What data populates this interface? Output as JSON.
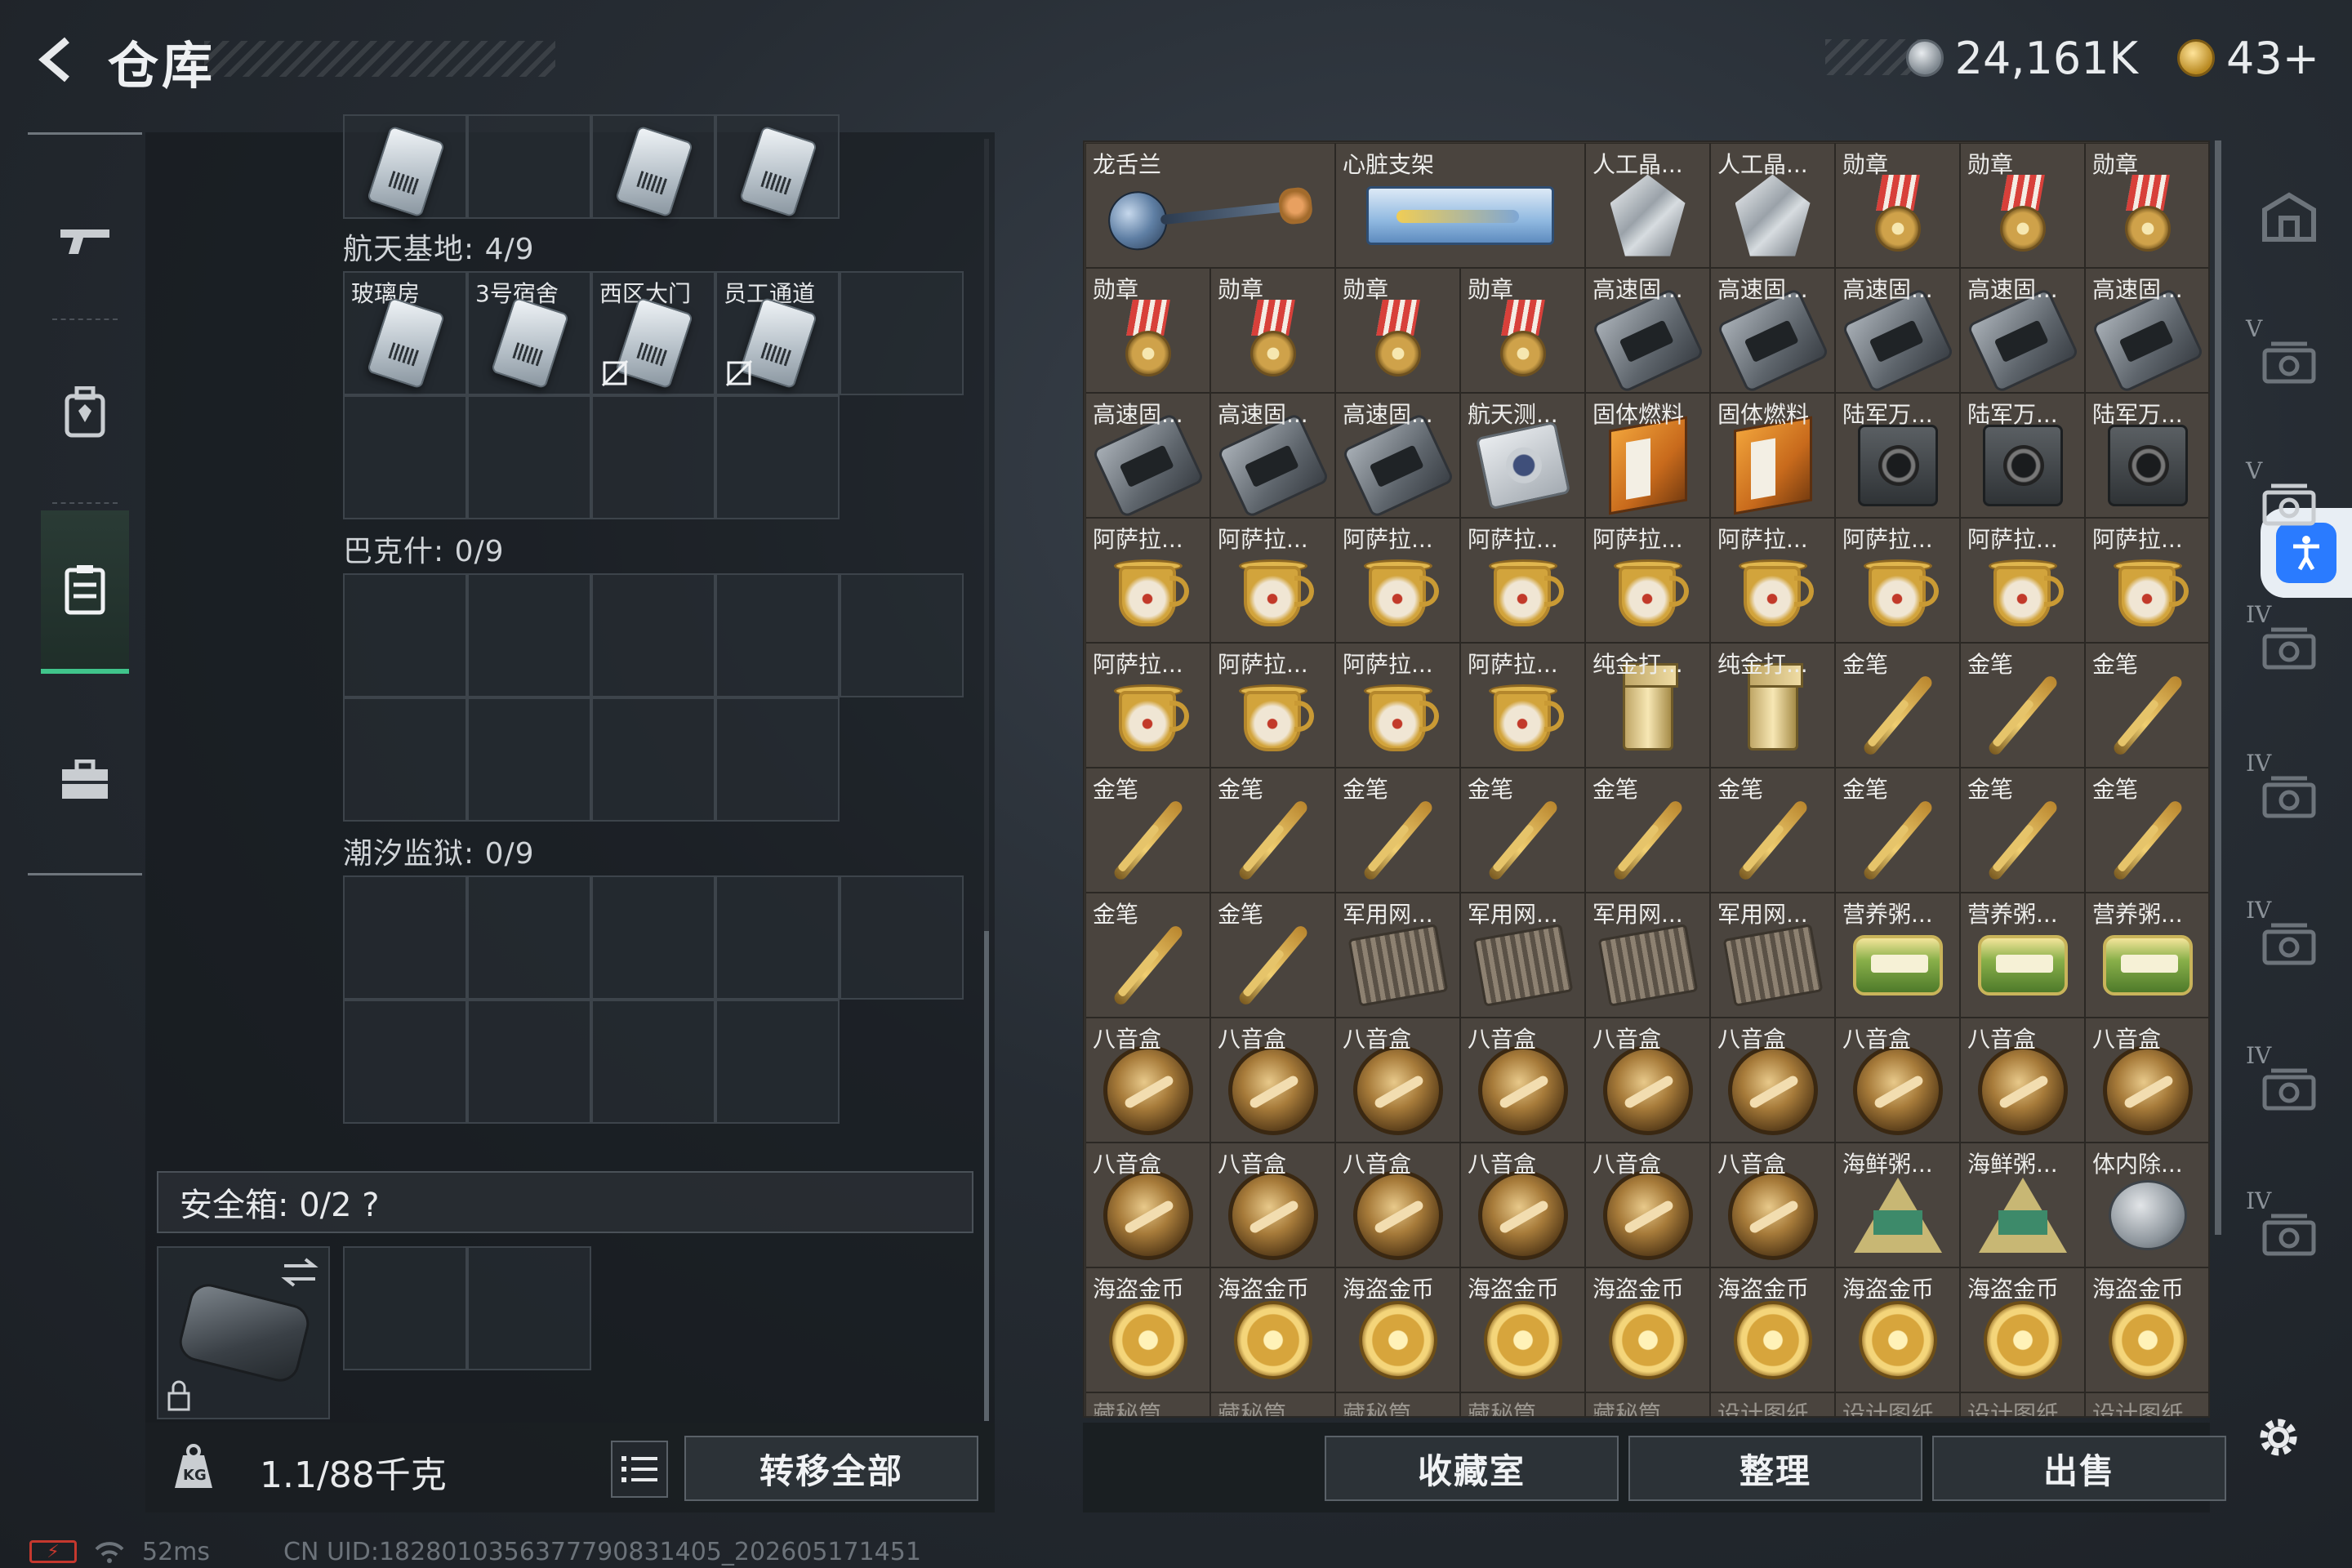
{
  "header": {
    "title": "仓库",
    "currency_silver": "24,161K",
    "currency_gold": "43+"
  },
  "left_nav": {
    "items": [
      "gun-icon",
      "backpack-icon",
      "storage-icon",
      "briefcase-icon"
    ],
    "active": "storage-icon"
  },
  "storage": {
    "top_partial_slots": [
      "",
      "",
      "",
      ""
    ],
    "sections": [
      {
        "label": "航天基地: 4/9",
        "slots": [
          "玻璃房",
          "3号宿舍",
          "西区大门",
          "员工通道"
        ]
      },
      {
        "label": "巴克什: 0/9"
      },
      {
        "label": "潮汐监狱: 0/9"
      }
    ],
    "safebox": {
      "label": "安全箱:  0/2  ?"
    },
    "weight": "1.1/88千克",
    "transfer_all": "转移全部"
  },
  "items": [
    [
      "龙舌兰",
      "",
      "心脏支架",
      "",
      "人工晶...",
      "人工晶...",
      "勋章",
      "勋章",
      "勋章"
    ],
    [
      "勋章",
      "勋章",
      "勋章",
      "勋章",
      "高速固...",
      "高速固...",
      "高速固...",
      "高速固...",
      "高速固..."
    ],
    [
      "高速固...",
      "高速固...",
      "高速固...",
      "航天测...",
      "固体燃料",
      "固体燃料",
      "陆军万...",
      "陆军万...",
      "陆军万..."
    ],
    [
      "阿萨拉...",
      "阿萨拉...",
      "阿萨拉...",
      "阿萨拉...",
      "阿萨拉...",
      "阿萨拉...",
      "阿萨拉...",
      "阿萨拉...",
      "阿萨拉..."
    ],
    [
      "阿萨拉...",
      "阿萨拉...",
      "阿萨拉...",
      "阿萨拉...",
      "纯金打...",
      "纯金打...",
      "金笔",
      "金笔",
      "金笔"
    ],
    [
      "金笔",
      "金笔",
      "金笔",
      "金笔",
      "金笔",
      "金笔",
      "金笔",
      "金笔",
      "金笔"
    ],
    [
      "金笔",
      "金笔",
      "军用网...",
      "军用网...",
      "军用网...",
      "军用网...",
      "营养粥...",
      "营养粥...",
      "营养粥..."
    ],
    [
      "八音盒",
      "八音盒",
      "八音盒",
      "八音盒",
      "八音盒",
      "八音盒",
      "八音盒",
      "八音盒",
      "八音盒"
    ],
    [
      "八音盒",
      "八音盒",
      "八音盒",
      "八音盒",
      "八音盒",
      "八音盒",
      "海鲜粥...",
      "海鲜粥...",
      "体内除..."
    ],
    [
      "海盗金币",
      "海盗金币",
      "海盗金币",
      "海盗金币",
      "海盗金币",
      "海盗金币",
      "海盗金币",
      "海盗金币",
      "海盗金币"
    ],
    [
      "藏秘筒",
      "藏秘筒",
      "藏秘筒",
      "藏秘筒",
      "藏秘筒",
      "设计图纸",
      "设计图纸",
      "设计图纸",
      "设计图纸"
    ]
  ],
  "bottom_buttons": {
    "collection": "收藏室",
    "organize": "整理",
    "sell": "出售"
  },
  "right_nav": {
    "tiers": [
      "",
      "V",
      "V",
      "IV",
      "IV",
      "IV",
      "IV",
      "IV",
      "IV"
    ]
  },
  "status_bar": {
    "ping": "52ms",
    "uid": "CN UID:1828010356377790831405_202605171451"
  }
}
